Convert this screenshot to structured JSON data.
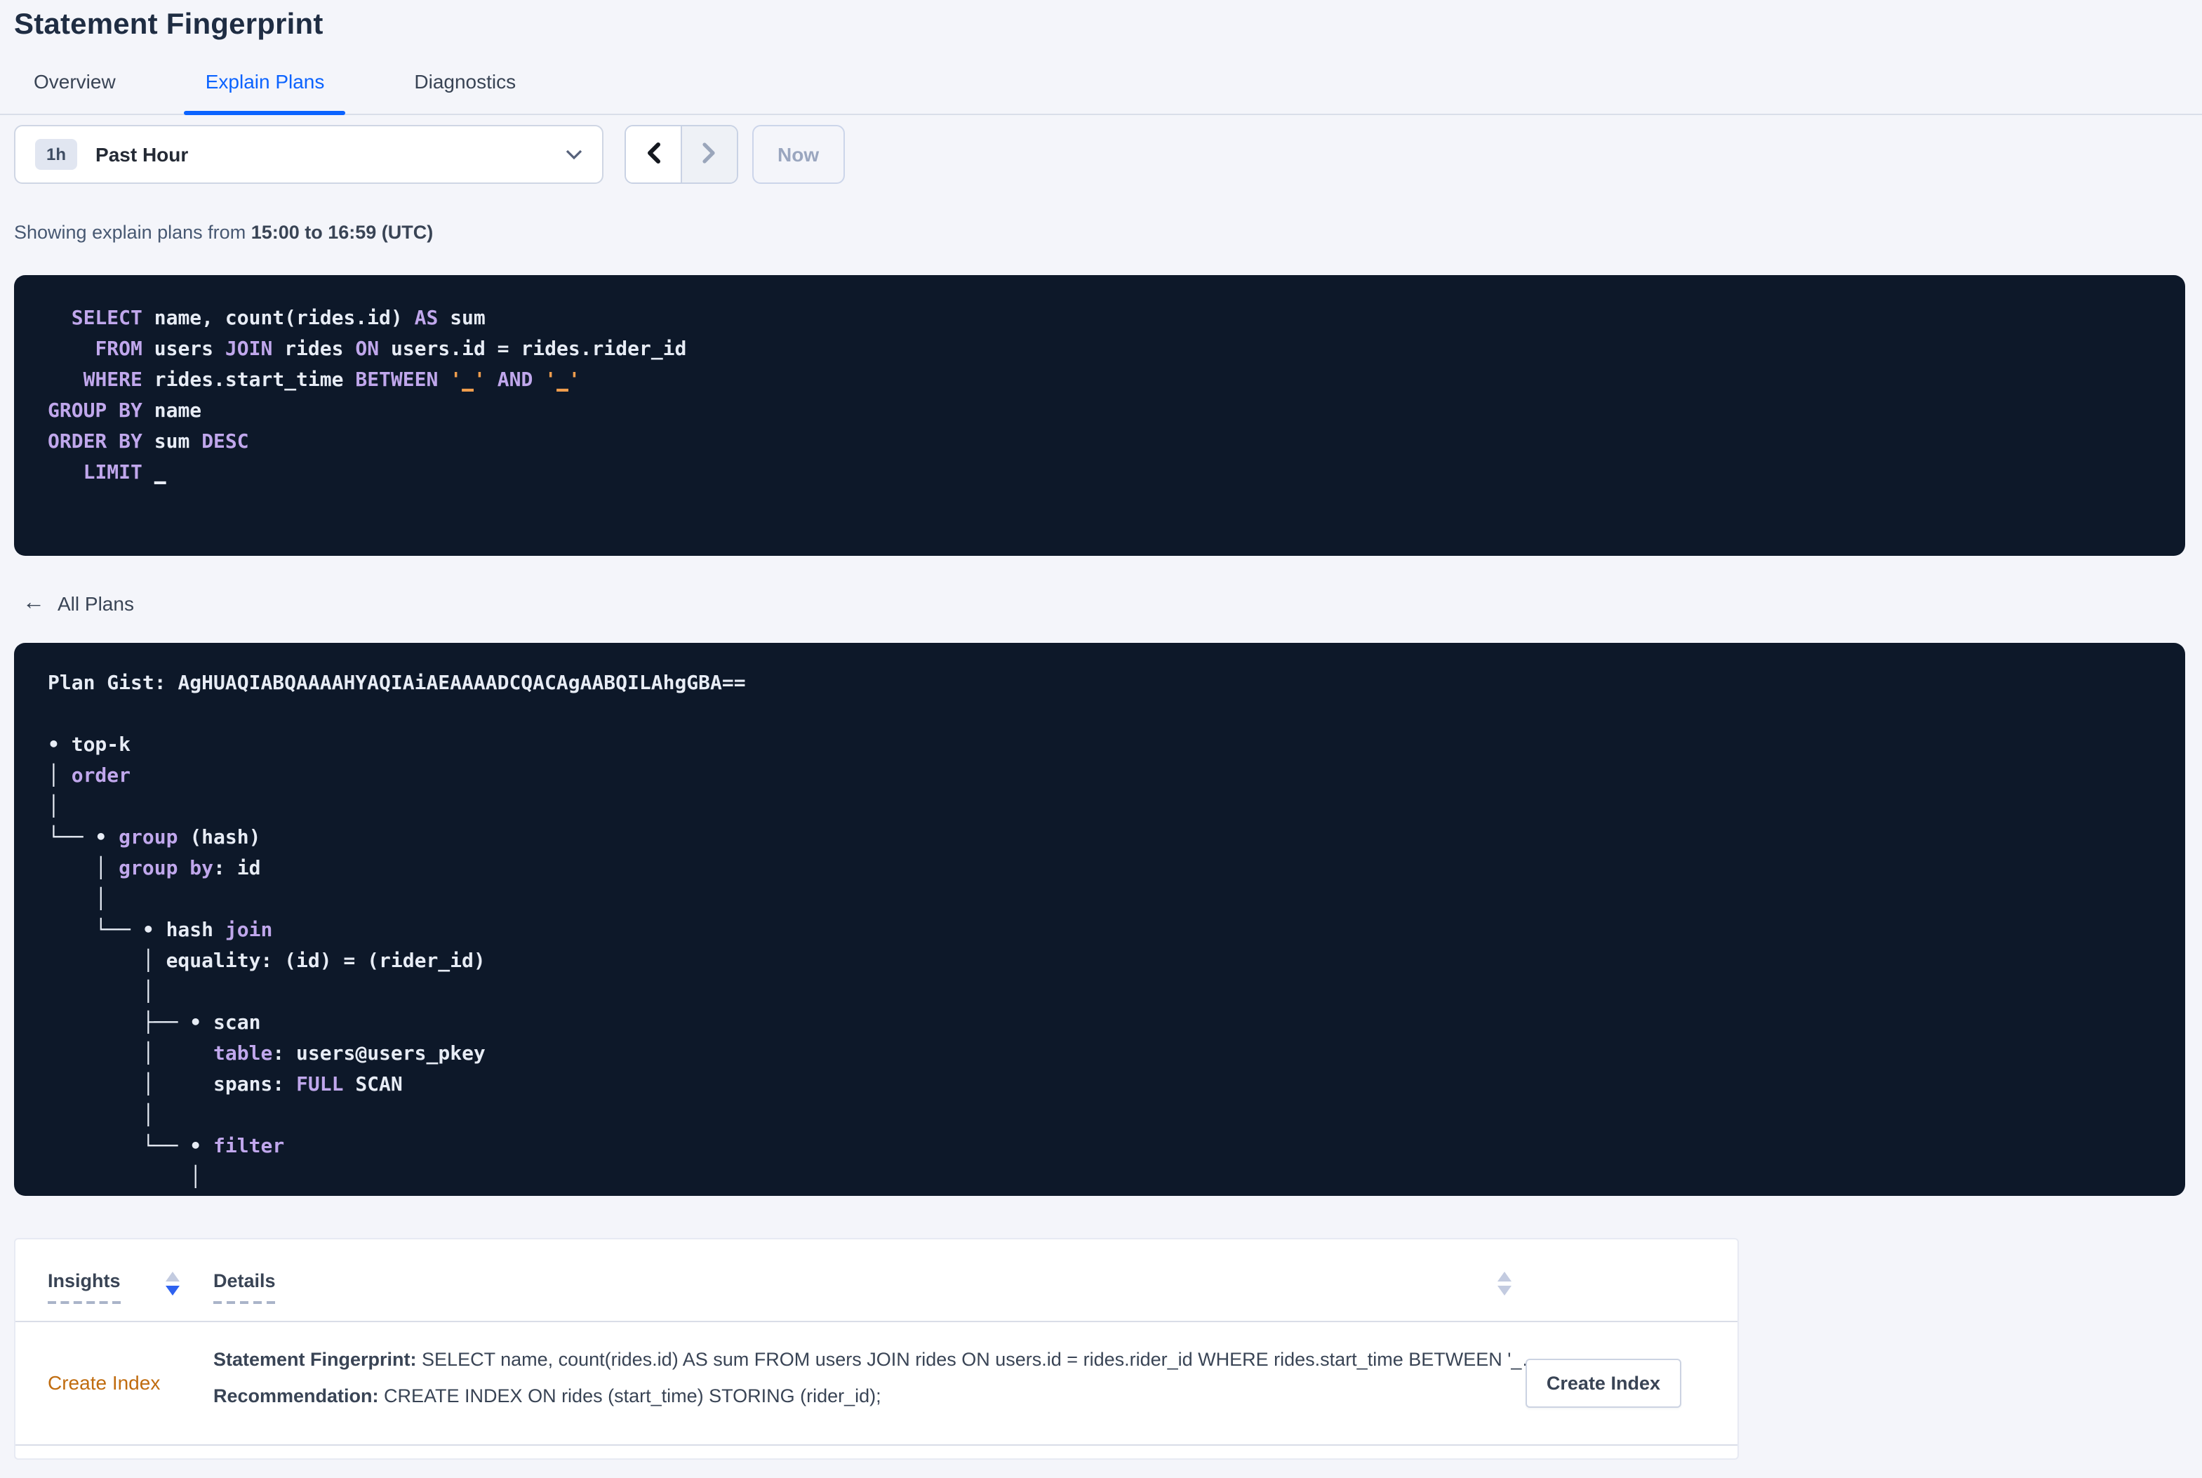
{
  "page": {
    "title": "Statement Fingerprint",
    "tabs": [
      {
        "label": "Overview",
        "active": false
      },
      {
        "label": "Explain Plans",
        "active": true
      },
      {
        "label": "Diagnostics",
        "active": false
      }
    ]
  },
  "time_picker": {
    "badge": "1h",
    "label": "Past Hour"
  },
  "nav": {
    "now_label": "Now"
  },
  "showing": {
    "prefix": "Showing explain plans from ",
    "range": "15:00 to 16:59 (UTC)"
  },
  "sql": {
    "statement": "SELECT name, count(rides.id) AS sum FROM users JOIN rides ON users.id = rides.rider_id WHERE rides.start_time BETWEEN '_' AND '_' GROUP BY name ORDER BY sum DESC LIMIT _",
    "lines": [
      [
        {
          "t": "  "
        },
        {
          "t": "SELECT",
          "c": "kw"
        },
        {
          "t": " name, count(rides.id) "
        },
        {
          "t": "AS",
          "c": "kw"
        },
        {
          "t": " sum"
        }
      ],
      [
        {
          "t": "    "
        },
        {
          "t": "FROM",
          "c": "kw"
        },
        {
          "t": " users "
        },
        {
          "t": "JOIN",
          "c": "kw"
        },
        {
          "t": " rides "
        },
        {
          "t": "ON",
          "c": "kw"
        },
        {
          "t": " users.id = rides.rider_id"
        }
      ],
      [
        {
          "t": "   "
        },
        {
          "t": "WHERE",
          "c": "kw"
        },
        {
          "t": " rides.start_time "
        },
        {
          "t": "BETWEEN",
          "c": "kw"
        },
        {
          "t": " "
        },
        {
          "t": "'",
          "c": "or"
        },
        {
          "t": "_",
          "c": "orl"
        },
        {
          "t": "'",
          "c": "or"
        },
        {
          "t": " "
        },
        {
          "t": "AND",
          "c": "kw"
        },
        {
          "t": " "
        },
        {
          "t": "'",
          "c": "or"
        },
        {
          "t": "_",
          "c": "orl"
        },
        {
          "t": "'",
          "c": "or"
        }
      ],
      [
        {
          "t": "GROUP BY",
          "c": "kw"
        },
        {
          "t": " name"
        }
      ],
      [
        {
          "t": "ORDER BY",
          "c": "kw"
        },
        {
          "t": " sum "
        },
        {
          "t": "DESC",
          "c": "kw"
        }
      ],
      [
        {
          "t": "   "
        },
        {
          "t": "LIMIT",
          "c": "kw"
        },
        {
          "t": " "
        },
        {
          "t": "_",
          "c": "ul"
        }
      ]
    ]
  },
  "plan": {
    "back_label": "All Plans",
    "gist_label": "Plan Gist: ",
    "gist": "AgHUAQIABQAAAAHYAQIAiAEAAAADCQACAgAABQILAhgGBA==",
    "tree": [
      [
        {
          "t": "• top-k"
        }
      ],
      [
        {
          "t": "│ "
        },
        {
          "t": "order",
          "c": "kw"
        }
      ],
      [
        {
          "t": "│"
        }
      ],
      [
        {
          "t": "└── • "
        },
        {
          "t": "group",
          "c": "kw"
        },
        {
          "t": " (hash)"
        }
      ],
      [
        {
          "t": "    │ "
        },
        {
          "t": "group by",
          "c": "kw"
        },
        {
          "t": ": id"
        }
      ],
      [
        {
          "t": "    │"
        }
      ],
      [
        {
          "t": "    └── • hash "
        },
        {
          "t": "join",
          "c": "kw"
        }
      ],
      [
        {
          "t": "        │ equality: (id) = (rider_id)"
        }
      ],
      [
        {
          "t": "        │"
        }
      ],
      [
        {
          "t": "        ├── • scan"
        }
      ],
      [
        {
          "t": "        │     "
        },
        {
          "t": "table",
          "c": "kw"
        },
        {
          "t": ": users@users_pkey"
        }
      ],
      [
        {
          "t": "        │     spans: "
        },
        {
          "t": "FULL",
          "c": "kw"
        },
        {
          "t": " SCAN"
        }
      ],
      [
        {
          "t": "        │"
        }
      ],
      [
        {
          "t": "        └── • "
        },
        {
          "t": "filter",
          "c": "kw"
        }
      ],
      [
        {
          "t": "            │"
        }
      ]
    ]
  },
  "table": {
    "headers": [
      "Insights",
      "Details"
    ],
    "row": {
      "insight": "Create Index",
      "fingerprint_label": "Statement Fingerprint:",
      "fingerprint": " SELECT name, count(rides.id) AS sum FROM users JOIN rides ON users.id = rides.rider_id WHERE rides.start_time BETWEEN '_…",
      "recommendation_label": "Recommendation:",
      "recommendation": " CREATE INDEX ON rides (start_time) STORING (rider_id);",
      "action_label": "Create Index"
    }
  },
  "colors": {
    "accent_blue": "#0b63ff",
    "code_background": "#0d1829",
    "code_keyword": "#c0a7ec",
    "code_literal": "#ef9d4d",
    "insight_link_orange": "#c06c0f",
    "page_background": "#f4f5fa",
    "body_text": "#394455"
  }
}
